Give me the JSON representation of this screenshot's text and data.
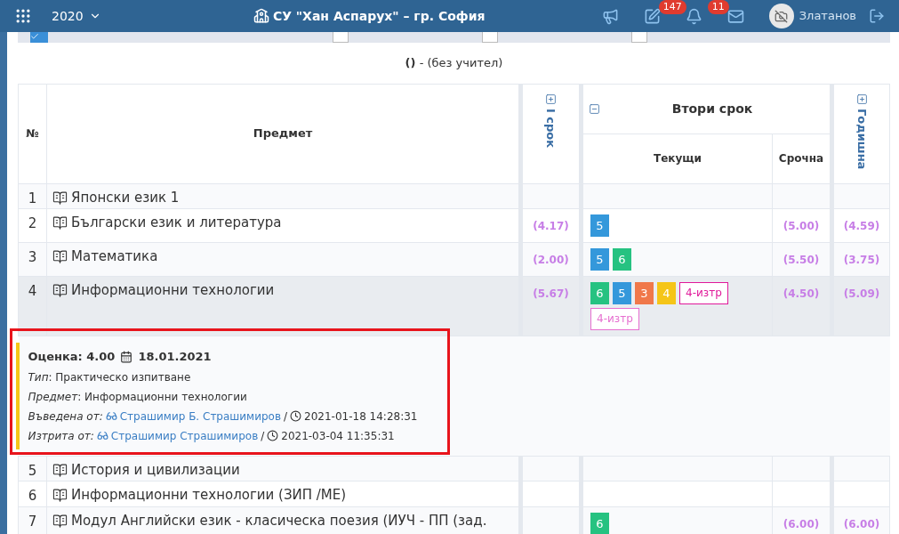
{
  "header": {
    "year": "2020",
    "title": "СУ \"Хан Аспарух\" – гр. София",
    "notifications": "147",
    "messages": "11",
    "user": "Златанов"
  },
  "filters": [
    {
      "checked": true
    },
    {
      "checked": false
    },
    {
      "checked": false
    },
    {
      "checked": false
    }
  ],
  "teacher_line": "**()** - (без учител)",
  "table": {
    "columns": {
      "number": "№",
      "subject": "Предмет",
      "term1": "I срок",
      "term2": "Втори срок",
      "current": "Текущи",
      "term_grade": "Срочна",
      "annual": "Годишна"
    },
    "term1_expanded": false,
    "term2_expanded": true,
    "annual_expanded": false,
    "rows": [
      {
        "number": "1",
        "subject": "Японски език 1",
        "selected": false,
        "grades": []
      },
      {
        "number": "2",
        "subject": "Български език и литература",
        "selected": false,
        "term1": "(4.17)",
        "grades": [
          {
            "kind": "grade",
            "value": "5",
            "color": "#3498db"
          }
        ],
        "term_grade": "(5.00)",
        "annual": "(4.59)"
      },
      {
        "number": "3",
        "subject": "Математика",
        "selected": false,
        "term1": "(2.00)",
        "grades": [
          {
            "kind": "grade",
            "value": "5",
            "color": "#3498db"
          },
          {
            "kind": "grade",
            "value": "6",
            "color": "#26c281"
          }
        ],
        "term_grade": "(5.50)",
        "annual": "(3.75)"
      },
      {
        "number": "4",
        "subject": "Информационни технологии",
        "selected": true,
        "term1": "(5.67)",
        "grades": [
          {
            "kind": "grade",
            "value": "6",
            "color": "#26c281"
          },
          {
            "kind": "grade",
            "value": "5",
            "color": "#3498db"
          },
          {
            "kind": "grade",
            "value": "3",
            "color": "#f0784a"
          },
          {
            "kind": "grade",
            "value": "4",
            "color": "#f5c518"
          },
          {
            "kind": "deleted",
            "value": "4-изтр",
            "color": "#e0199a"
          },
          {
            "kind": "deleted",
            "value": "4-изтр",
            "color": "#e66fd0"
          }
        ],
        "term_grade": "(4.50)",
        "annual": "(5.09)",
        "detail": {
          "title": "Оценка: 4.00",
          "date": "18.01.2021",
          "lines": [
            "*Тип*: Практическо изпитване",
            "*Предмет*: Информационни технологии"
          ],
          "audit": [
            {
              "label": "Въведена от:",
              "person": "Страшимир Б. Страшимиров",
              "separator": "/",
              "time": "2021-01-18 14:28:31"
            },
            {
              "label": "Изтрита от:",
              "person": "Страшимир Страшимиров",
              "separator": "/",
              "time": "2021-03-04 11:35:31"
            }
          ]
        }
      },
      {
        "number": "5",
        "subject": "История и цивилизации",
        "selected": false,
        "grades": []
      },
      {
        "number": "6",
        "subject": "Информационни технологии (ЗИП /МЕ)",
        "selected": false,
        "grades": []
      },
      {
        "number": "7",
        "subject": "Модул Английски език - класическа поезия (ИУЧ - ПП (зад.",
        "selected": false,
        "grades": [
          {
            "kind": "grade",
            "value": "6",
            "color": "#26c281"
          }
        ],
        "term_grade": "(6.00)",
        "annual": "(6.00)"
      }
    ]
  }
}
